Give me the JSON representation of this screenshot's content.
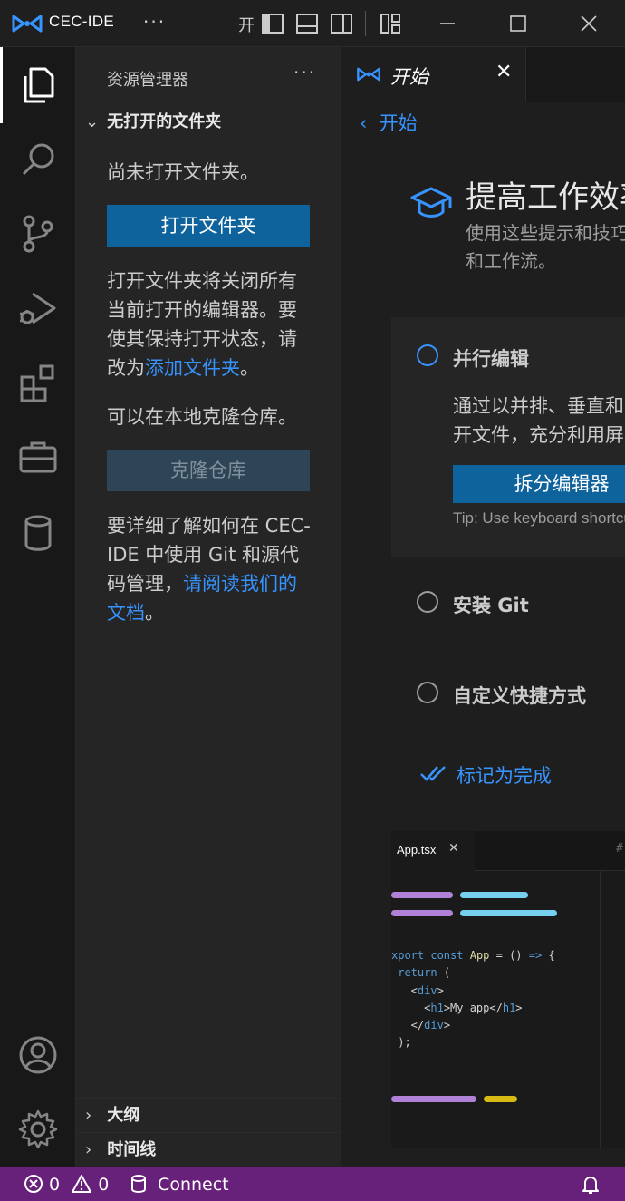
{
  "titlebar": {
    "app_name": "CEC-IDE",
    "more": "···",
    "open_label": "开"
  },
  "sidebar": {
    "title": "资源管理器",
    "more": "···",
    "section_title": "无打开的文件夹",
    "no_folder_text": "尚未打开文件夹。",
    "open_folder_button": "打开文件夹",
    "open_info_text": "打开文件夹将关闭所有当前打开的编辑器。要使其保持打开状态，请改为",
    "add_folder_link": "添加文件夹",
    "period": "。",
    "clone_info_text": "可以在本地克隆仓库。",
    "clone_button": "克隆仓库",
    "git_info_text": "要详细了解如何在 CEC-IDE 中使用 Git 和源代码管理，",
    "docs_link": "请阅读我们的文档",
    "outline_label": "大纲",
    "timeline_label": "时间线"
  },
  "editor": {
    "tab_label": "开始",
    "tab_close": "✕",
    "back_label": "开始",
    "walkthrough_title": "提高工作效率",
    "walkthrough_subtitle": "使用这些提示和技巧提高工作效率和工作流。",
    "steps": [
      {
        "title": "并行编辑",
        "description": "通过以并排、垂直和网格布局打开文件，充分利用屏幕空间。",
        "button": "拆分编辑器",
        "tip": "Tip: Use keyboard shortcut"
      },
      {
        "title": "安装 Git"
      },
      {
        "title": "自定义快捷方式"
      }
    ],
    "mark_done": "标记为完成",
    "preview": {
      "tab_label": "App.tsx",
      "tab_close": "✕",
      "hash": "#",
      "colors": {
        "purple": "#b180d7",
        "cyan": "#75d0f0",
        "yellow": "#d7ba13"
      }
    }
  },
  "statusbar": {
    "errors": "0",
    "warnings": "0",
    "connect": "Connect"
  },
  "colors": {
    "accent": "#0e639c",
    "link": "#3794ff",
    "statusbar": "#68217a"
  }
}
